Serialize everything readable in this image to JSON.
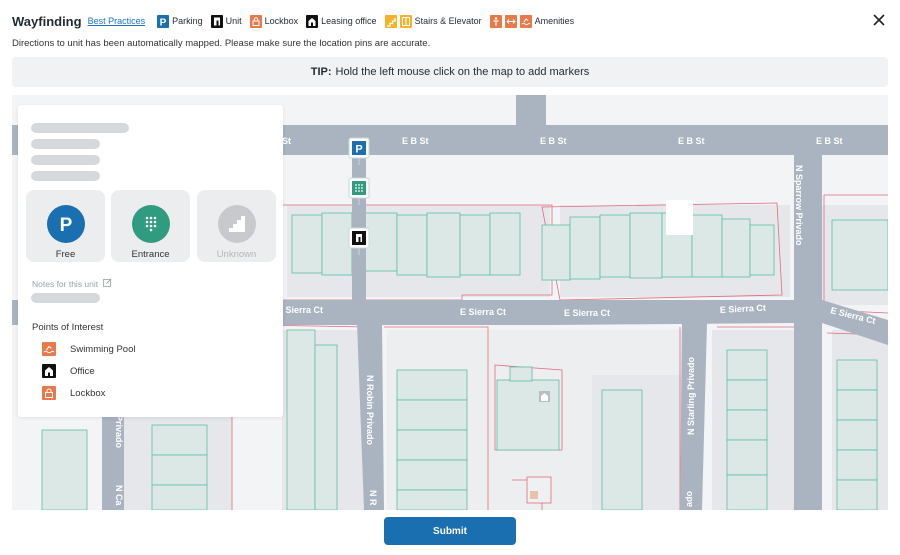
{
  "header": {
    "title": "Wayfinding",
    "best_practices": "Best Practices",
    "legend": [
      {
        "label": "Parking",
        "color": "#1a6fb0"
      },
      {
        "label": "Unit",
        "color": "#111111"
      },
      {
        "label": "Lockbox",
        "color": "#e8794a"
      },
      {
        "label": "Leasing office",
        "color": "#111111"
      },
      {
        "label": "Stairs & Elevator",
        "color": "#f4b32a"
      },
      {
        "label": "Amenities",
        "color": "#e8794a"
      }
    ],
    "close_icon": "close-icon"
  },
  "subtitle": "Directions to unit has been automatically mapped. Please make sure the location pins are accurate.",
  "tip": {
    "bold": "TIP:",
    "text": "Hold the left mouse click on the map to add markers"
  },
  "map": {
    "streets": [
      "E B St",
      "E B St",
      "E B St",
      "E B St",
      "E B St",
      "E Sierra Ct",
      "E Sierra Ct",
      "E Sierra Ct",
      "E Sierra Ct",
      "E Sierra Ct",
      "N Sparrow Privado",
      "N Robin Privado",
      "N Starling Privado",
      "al Privado",
      "N Ca",
      "N R",
      "ado"
    ],
    "marker_letters": {
      "parking": "P"
    }
  },
  "panel": {
    "pins": [
      {
        "label": "Free",
        "icon": "parking-icon",
        "letter": "P",
        "color": "#1a6fb0"
      },
      {
        "label": "Entrance",
        "icon": "keypad-icon",
        "color": "#2f9c82"
      },
      {
        "label": "Unknown",
        "icon": "stairs-icon",
        "color": "#c7c9cc"
      }
    ],
    "notes_label": "Notes for this unit",
    "poi_title": "Points of Interest",
    "poi": [
      {
        "label": "Swimming Pool",
        "icon": "pool-icon",
        "color": "#e8794a"
      },
      {
        "label": "Office",
        "icon": "office-icon",
        "color": "#111111"
      },
      {
        "label": "Lockbox",
        "icon": "lockbox-icon",
        "color": "#e8794a"
      }
    ]
  },
  "submit_label": "Submit",
  "colors": {
    "accent": "#1a6fb0",
    "road": "#aab4c0",
    "building_fill": "#dbe8e6",
    "building_stroke": "#5bbfa6",
    "parcel_stroke": "#e26b7e"
  }
}
